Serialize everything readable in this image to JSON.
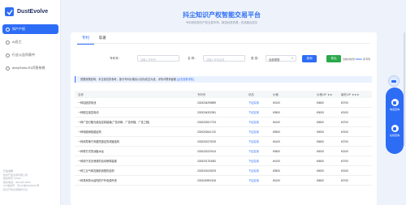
{
  "sidebar": {
    "logo_text": "DustEvolve",
    "nav": [
      {
        "label": "知产产权",
        "icon": "document-icon"
      },
      {
        "label": "AI员工",
        "icon": "robot-icon"
      },
      {
        "label": "行业公告列表中",
        "icon": "list-icon"
      },
      {
        "label": "deepSeek-R1问答系统",
        "icon": "chat-icon"
      }
    ],
    "footer": {
      "heading": "行业资质",
      "lines": [
        "技术产权交易有限公司",
        "版权所有 ©2024",
        "联系电话：400-000-0000",
        "ICP备案号：京ICP备00000000号",
        "知识产权交易服务平台"
      ]
    }
  },
  "header": {
    "title": "抖尘知识产权智能交易平台",
    "subtitle": "专利商标知识产权交易市场，精选优质资源，在线撮合成交"
  },
  "tabs": [
    "专利",
    "软著"
  ],
  "filters": {
    "patent_no_label": "专利号：",
    "patent_no_placeholder": "请输入专利号",
    "name_label": "名 称：",
    "name_placeholder": "请输入专利名称",
    "type_label": "类 型：",
    "type_value": "全部类型",
    "search_label": "查询",
    "export_label": "导出",
    "total_prefix": "当前共检到 ",
    "total_count": "1500+",
    "total_suffix": " 条专利"
  },
  "notice": {
    "text": "受限政策影响，本交易仅供参考，部分专利价格请以实际成交为准，详情可联系客服",
    "highlight": "[点击查看详情]"
  },
  "table": {
    "columns": [
      "名称",
      "专利号",
      "状态",
      "价格",
      "价格VIP ★★",
      "最低VIP ★★★"
    ],
    "rows": [
      [
        "一种由固态电池",
        "2025204298899",
        "下证实用",
        "¥4100",
        "¥3600",
        "¥2700"
      ],
      [
        "一种航空遥控电动",
        "2025204332951",
        "下证实用",
        "¥3500",
        "¥3000",
        "¥2100"
      ],
      [
        "一种广告灯箱光源及控制装置(广告印刷、广告传媒、广告工程)",
        "2025202917703",
        "下证实用",
        "¥4100",
        "¥3600",
        "¥2700"
      ],
      [
        "一种电磁阀吸能结构",
        "2025202641742",
        "下证实用",
        "¥3500",
        "¥3000",
        "¥2100"
      ],
      [
        "一种用导管于床腿托固定的调速结构",
        "2025202275219",
        "下证实用",
        "¥4100",
        "¥3600",
        "¥2700"
      ],
      [
        "一种带方式的涂脂水龙",
        "2025202229143",
        "下证实用",
        "¥3500",
        "¥3000",
        "¥2100"
      ],
      [
        "一种用于农业喷淋的自动喷嘴装置",
        "2025201753052",
        "下证实用",
        "¥4100",
        "¥3600",
        "¥2700"
      ],
      [
        "一种工业气体压缩机用散热结构",
        "2025201028375",
        "下证实用",
        "¥3500",
        "¥3000",
        "¥2100"
      ],
      [
        "一种具有防水结构的户外电源外壳",
        "2025200992106",
        "下证实用",
        "¥4100",
        "¥3600",
        "¥2700"
      ]
    ]
  },
  "float_panel": {
    "items": [
      {
        "label": "电话咨询",
        "icon": "phone-icon"
      },
      {
        "label": "在线咨询",
        "icon": "chat-icon"
      }
    ]
  },
  "colors": {
    "accent": "#2d6df6",
    "success": "#2aa84a"
  }
}
